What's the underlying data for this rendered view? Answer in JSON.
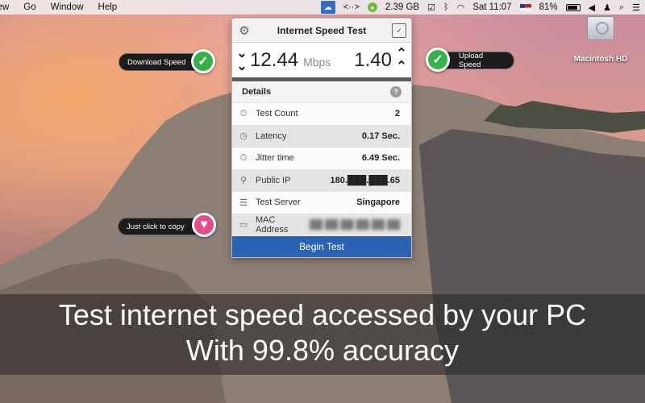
{
  "menubar": {
    "left_items": [
      "iew",
      "Go",
      "Window",
      "Help"
    ],
    "right": {
      "network_icon": "<··>",
      "memory": "2.39 GB",
      "clock": "Sat 11:07",
      "battery": "81%"
    }
  },
  "desktop": {
    "hd_label": "Macintosh HD"
  },
  "panel": {
    "title": "Internet Speed Test",
    "download_value": "12.44",
    "unit": "Mbps",
    "upload_value": "1.40",
    "details_label": "Details",
    "help_glyph": "?",
    "rows": [
      {
        "label": "Test Count",
        "value": "2",
        "icon": "stopwatch-icon"
      },
      {
        "label": "Latency",
        "value": "0.17 Sec.",
        "icon": "clock-icon"
      },
      {
        "label": "Jitter time",
        "value": "6.49 Sec.",
        "icon": "stopwatch-icon"
      },
      {
        "label": "Public IP",
        "value": "180.███.███.65",
        "icon": "network-icon"
      },
      {
        "label": "Test Server",
        "value": "Singapore",
        "icon": "server-icon"
      },
      {
        "label": "MAC Address",
        "value": "██:██:██:██:██:██",
        "icon": "monitor-icon"
      }
    ],
    "begin_label": "Begin Test"
  },
  "callouts": {
    "download": "Download Speed",
    "upload": "Upload Speed",
    "copy": "Just click to copy"
  },
  "caption": {
    "line1": "Test internet speed accessed by your PC",
    "line2": "With 99.8% accuracy"
  }
}
